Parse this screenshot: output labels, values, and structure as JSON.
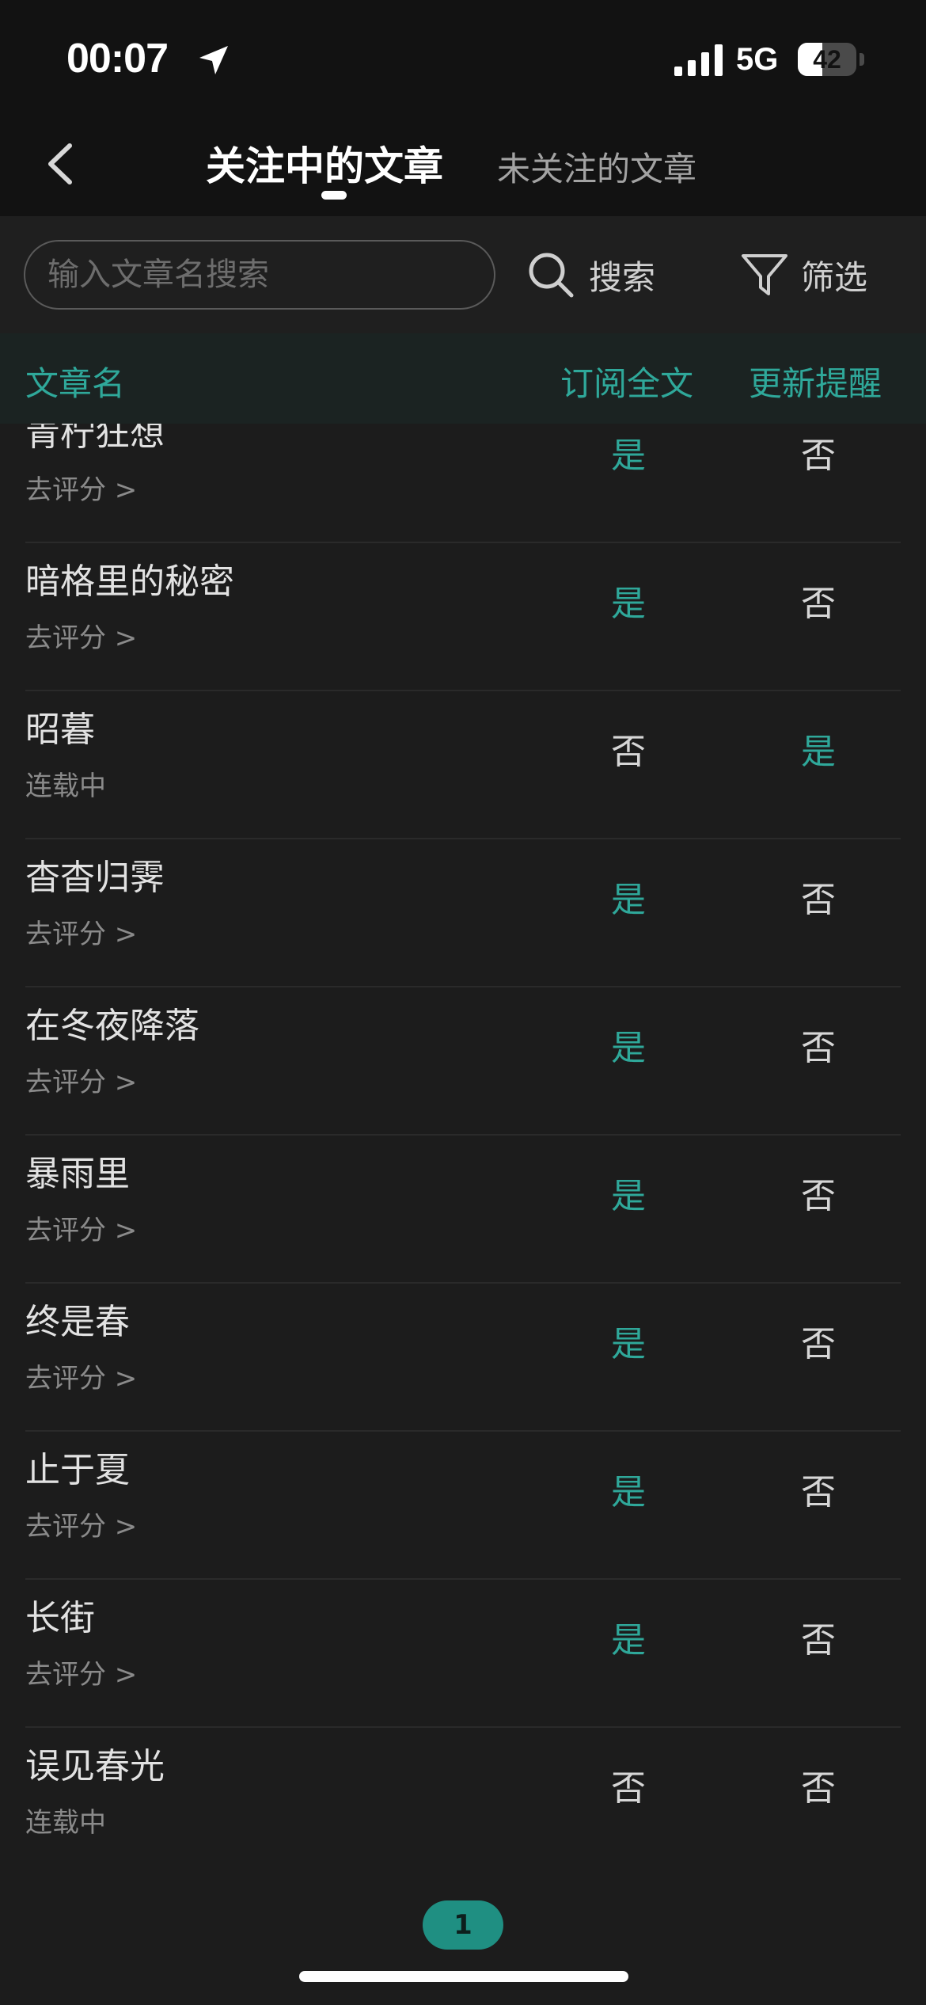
{
  "status_bar": {
    "time": "00:07",
    "network": "5G",
    "battery_level": "42",
    "battery_fraction": 0.42
  },
  "nav": {
    "tab_following": "关注中的文章",
    "tab_unfollowed": "未关注的文章"
  },
  "search": {
    "placeholder": "输入文章名搜索",
    "search_label": "搜索",
    "filter_label": "筛选"
  },
  "table": {
    "headers": {
      "name": "文章名",
      "subscribe_full": "订阅全文",
      "update_reminder": "更新提醒"
    },
    "rows": [
      {
        "title": "青柠狂想",
        "status": "去评分 >",
        "subscribe": "是",
        "reminder": "否"
      },
      {
        "title": "暗格里的秘密",
        "status": "去评分 >",
        "subscribe": "是",
        "reminder": "否"
      },
      {
        "title": "昭暮",
        "status": "连载中",
        "subscribe": "否",
        "reminder": "是"
      },
      {
        "title": "杳杳归霁",
        "status": "去评分 >",
        "subscribe": "是",
        "reminder": "否"
      },
      {
        "title": "在冬夜降落",
        "status": "去评分 >",
        "subscribe": "是",
        "reminder": "否"
      },
      {
        "title": "暴雨里",
        "status": "去评分 >",
        "subscribe": "是",
        "reminder": "否"
      },
      {
        "title": "终是春",
        "status": "去评分 >",
        "subscribe": "是",
        "reminder": "否"
      },
      {
        "title": "止于夏",
        "status": "去评分 >",
        "subscribe": "是",
        "reminder": "否"
      },
      {
        "title": "长街",
        "status": "去评分 >",
        "subscribe": "是",
        "reminder": "否"
      },
      {
        "title": "误见春光",
        "status": "连载中",
        "subscribe": "否",
        "reminder": "否"
      }
    ]
  },
  "pagination": {
    "current_page": "1"
  },
  "colors": {
    "accent": "#2fa89a",
    "background": "#1c1c1c",
    "header_bg": "#121212"
  }
}
